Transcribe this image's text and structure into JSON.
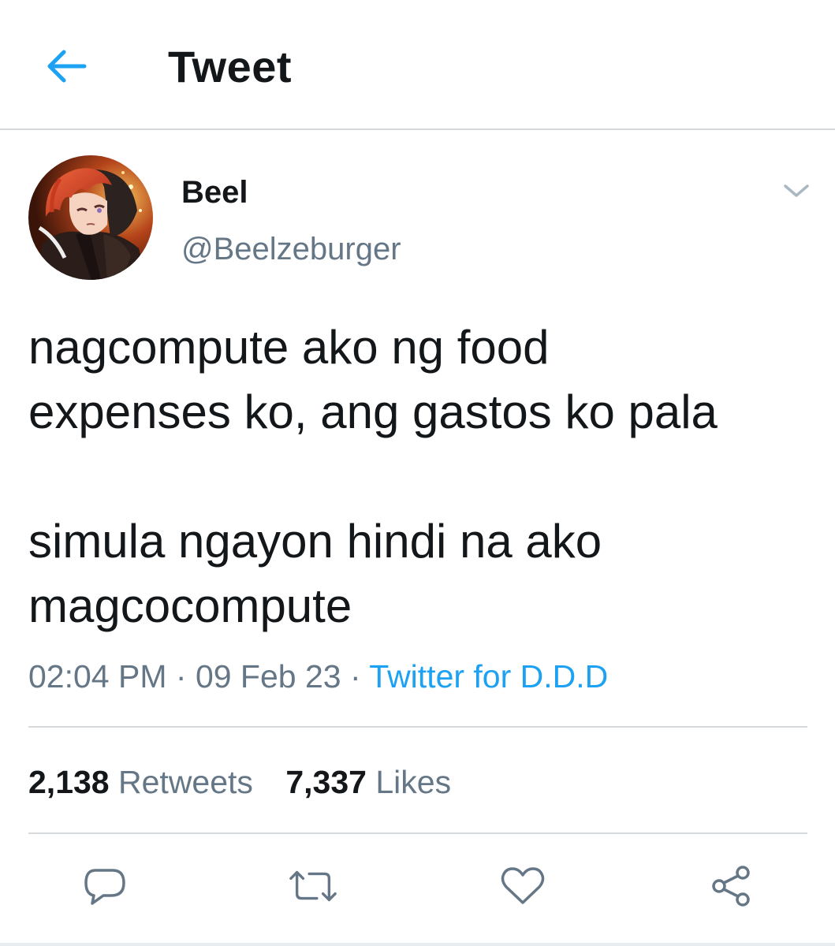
{
  "header": {
    "title": "Tweet",
    "back_icon": "arrow-left-icon",
    "accent_color": "#1da1f2"
  },
  "tweet": {
    "author": {
      "display_name": "Beel",
      "handle": "@Beelzeburger",
      "avatar_icon": "avatar-image"
    },
    "menu_icon": "chevron-down-icon",
    "text_lines": [
      "nagcompute ako ng food",
      "expenses ko, ang gastos ko pala",
      "",
      "simula ngayon hindi na ako",
      "magcocompute"
    ],
    "meta": {
      "time": "02:04 PM",
      "separator": " · ",
      "date": "09 Feb 23",
      "source": "Twitter for D.D.D"
    },
    "stats": {
      "retweets_count": "2,138",
      "retweets_label": "Retweets",
      "likes_count": "7,337",
      "likes_label": "Likes"
    },
    "actions": [
      {
        "icon": "reply-icon"
      },
      {
        "icon": "retweet-icon"
      },
      {
        "icon": "heart-icon"
      },
      {
        "icon": "share-icon"
      }
    ]
  },
  "colors": {
    "text_primary": "#14171a",
    "text_secondary": "#657786",
    "link": "#1da1f2",
    "divider": "#d6dadd"
  }
}
